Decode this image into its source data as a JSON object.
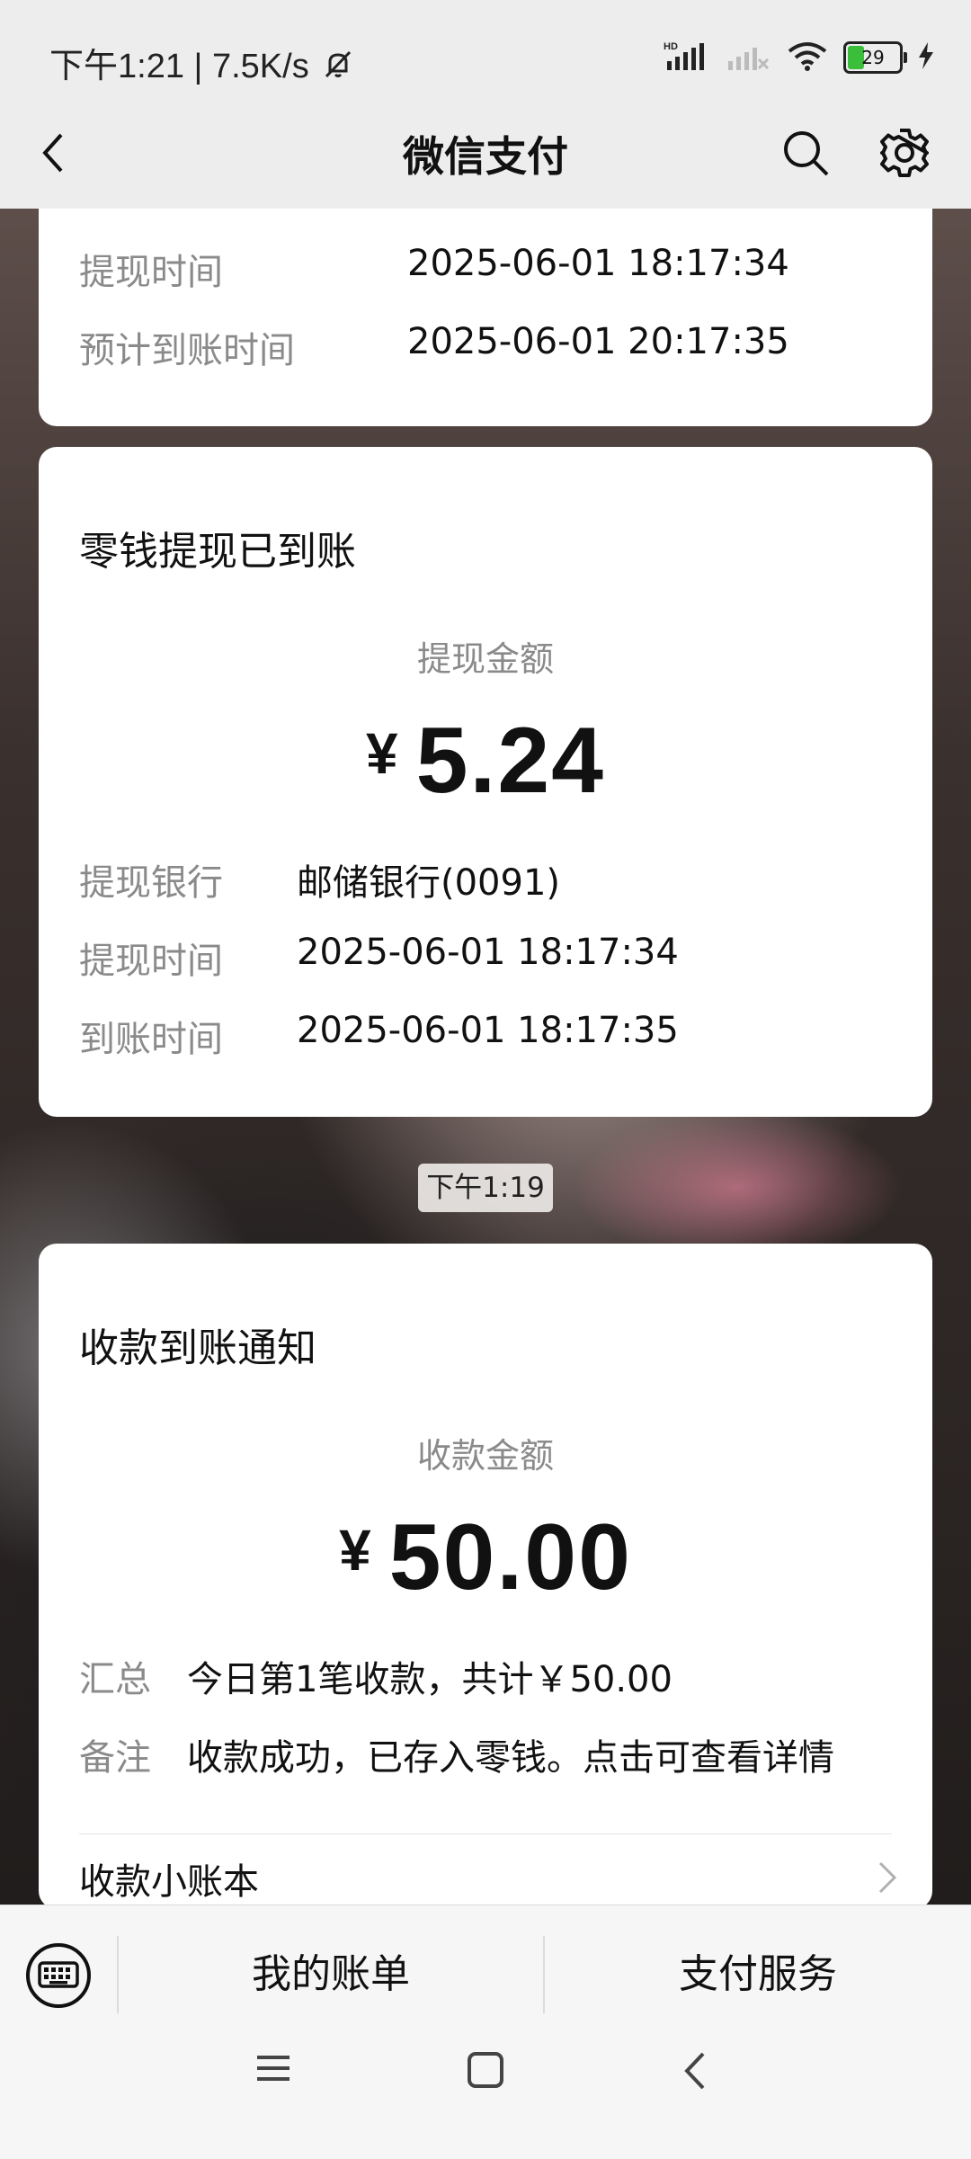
{
  "status_bar": {
    "time": "下午1:21",
    "separator": "|",
    "speed": "7.5K/s",
    "battery": "29",
    "icons": [
      "mute-bell-icon",
      "hd-signal-icon",
      "signal-icon",
      "wifi-icon",
      "battery-icon",
      "charging-icon"
    ]
  },
  "nav": {
    "title": "微信支付",
    "back_icon": "back-arrow-icon",
    "search_icon": "search-icon",
    "settings_icon": "gear-icon"
  },
  "card_partial": {
    "rows": [
      {
        "label": "提现时间",
        "value": "2025-06-01 18:17:34"
      },
      {
        "label": "预计到账时间",
        "value": "2025-06-01 20:17:35"
      }
    ]
  },
  "card_withdraw": {
    "title": "零钱提现已到账",
    "amount_label": "提现金额",
    "currency": "¥",
    "amount": "5.24",
    "rows": [
      {
        "label": "提现银行",
        "value": "邮储银行(0091)"
      },
      {
        "label": "提现时间",
        "value": "2025-06-01 18:17:34"
      },
      {
        "label": "到账时间",
        "value": "2025-06-01 18:17:35"
      }
    ]
  },
  "timestamp": "下午1:19",
  "card_receive": {
    "title": "收款到账通知",
    "amount_label": "收款金额",
    "currency": "¥",
    "amount": "50.00",
    "rows": [
      {
        "label": "汇总",
        "value": "今日第1笔收款，共计￥50.00"
      },
      {
        "label": "备注",
        "value": "收款成功，已存入零钱。点击可查看详情"
      }
    ],
    "link_label": "收款小账本"
  },
  "bottom_menu": {
    "keyboard_icon": "keyboard-icon",
    "bill_label": "我的账单",
    "service_label": "支付服务"
  },
  "system_nav": [
    "menu-icon",
    "home-icon",
    "back-icon"
  ]
}
